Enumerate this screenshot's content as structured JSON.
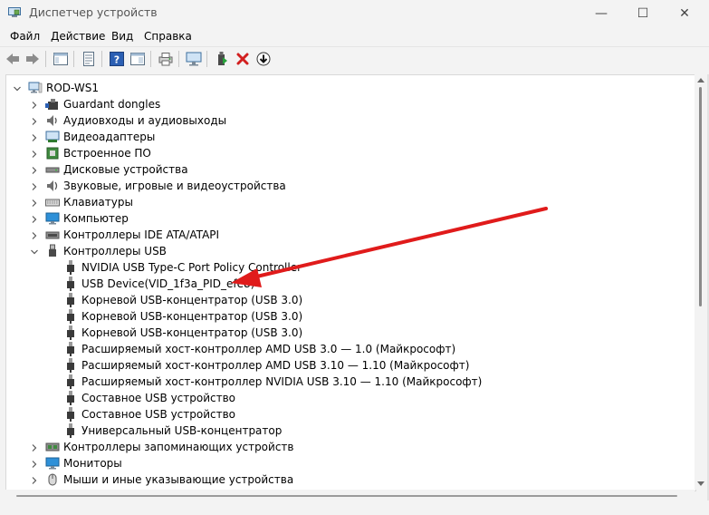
{
  "window": {
    "title": "Диспетчер устройств",
    "controls": {
      "minimize": "—",
      "maximize": "☐",
      "close": "✕"
    }
  },
  "menu": {
    "items": [
      "Файл",
      "Действие",
      "Вид",
      "Справка"
    ]
  },
  "tree": {
    "root": "ROD-WS1",
    "categories": [
      "Guardant dongles",
      "Аудиовходы и аудиовыходы",
      "Видеоадаптеры",
      "Встроенное ПО",
      "Дисковые устройства",
      "Звуковые, игровые и видеоустройства",
      "Клавиатуры",
      "Компьютер",
      "Контроллеры IDE ATA/ATAPI",
      "Контроллеры USB",
      "Контроллеры запоминающих устройств",
      "Мониторы",
      "Мыши и иные указывающие устройства"
    ],
    "usb_devices": [
      "NVIDIA USB Type-C Port Policy Controller",
      "USB Device(VID_1f3a_PID_efe8)",
      "Корневой USB-концентратор (USB 3.0)",
      "Корневой USB-концентратор (USB 3.0)",
      "Корневой USB-концентратор (USB 3.0)",
      "Расширяемый хост-контроллер AMD USB 3.0 — 1.0 (Майкрософт)",
      "Расширяемый хост-контроллер AMD USB 3.10 — 1.10 (Майкрософт)",
      "Расширяемый хост-контроллер NVIDIA USB 3.10 — 1.10 (Майкрософт)",
      "Составное USB устройство",
      "Составное USB устройство",
      "Универсальный USB-концентратор"
    ]
  },
  "colors": {
    "annotation_arrow": "#e01b1b",
    "accent": "#0067c0"
  }
}
